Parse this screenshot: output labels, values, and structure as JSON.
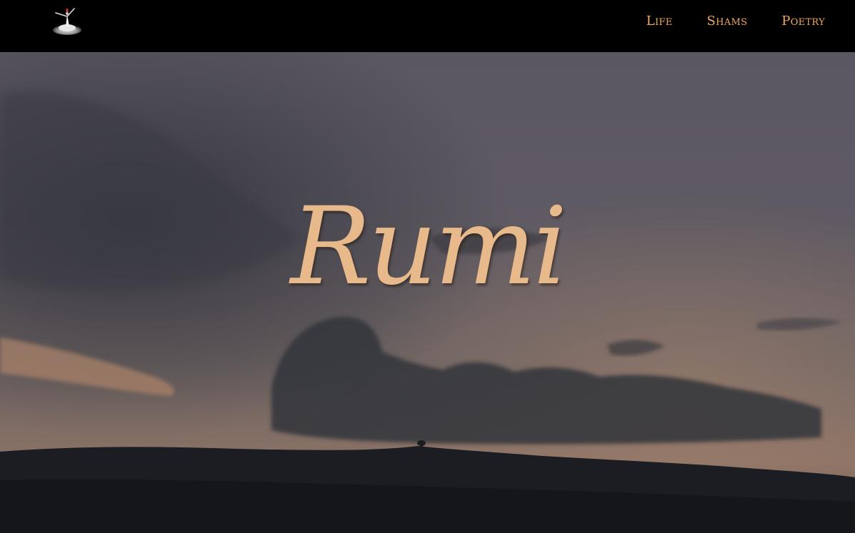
{
  "header": {
    "logo_icon": "whirling-dervish-icon",
    "nav": [
      {
        "label": "Life"
      },
      {
        "label": "Shams"
      },
      {
        "label": "Poetry"
      }
    ]
  },
  "hero": {
    "title": "Rumi",
    "background": "dusk-sky-clouds-over-hills"
  },
  "colors": {
    "header_bg": "#000000",
    "nav_text": "#f0a85a",
    "title": "#e8b98b"
  }
}
